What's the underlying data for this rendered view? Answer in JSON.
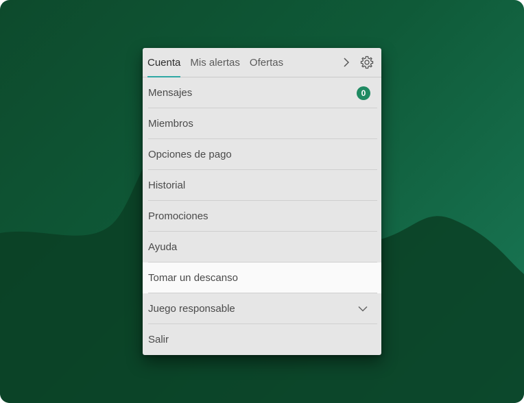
{
  "tabs": [
    {
      "label": "Cuenta",
      "active": true
    },
    {
      "label": "Mis alertas",
      "active": false
    },
    {
      "label": "Ofertas",
      "active": false
    }
  ],
  "icons": {
    "next": "chevron-right-icon",
    "settings": "gear-icon",
    "expand": "chevron-down-icon"
  },
  "menu": {
    "items": [
      {
        "label": "Mensajes",
        "badge": "0"
      },
      {
        "label": "Miembros"
      },
      {
        "label": "Opciones de pago"
      },
      {
        "label": "Historial"
      },
      {
        "label": "Promociones"
      },
      {
        "label": "Ayuda"
      },
      {
        "label": "Tomar un descanso",
        "highlighted": true
      },
      {
        "label": "Juego responsable",
        "expandable": true
      },
      {
        "label": "Salir"
      }
    ]
  },
  "colors": {
    "accent": "#2fa8a4",
    "badge": "#1f8a62",
    "background": "#0f5a38"
  }
}
